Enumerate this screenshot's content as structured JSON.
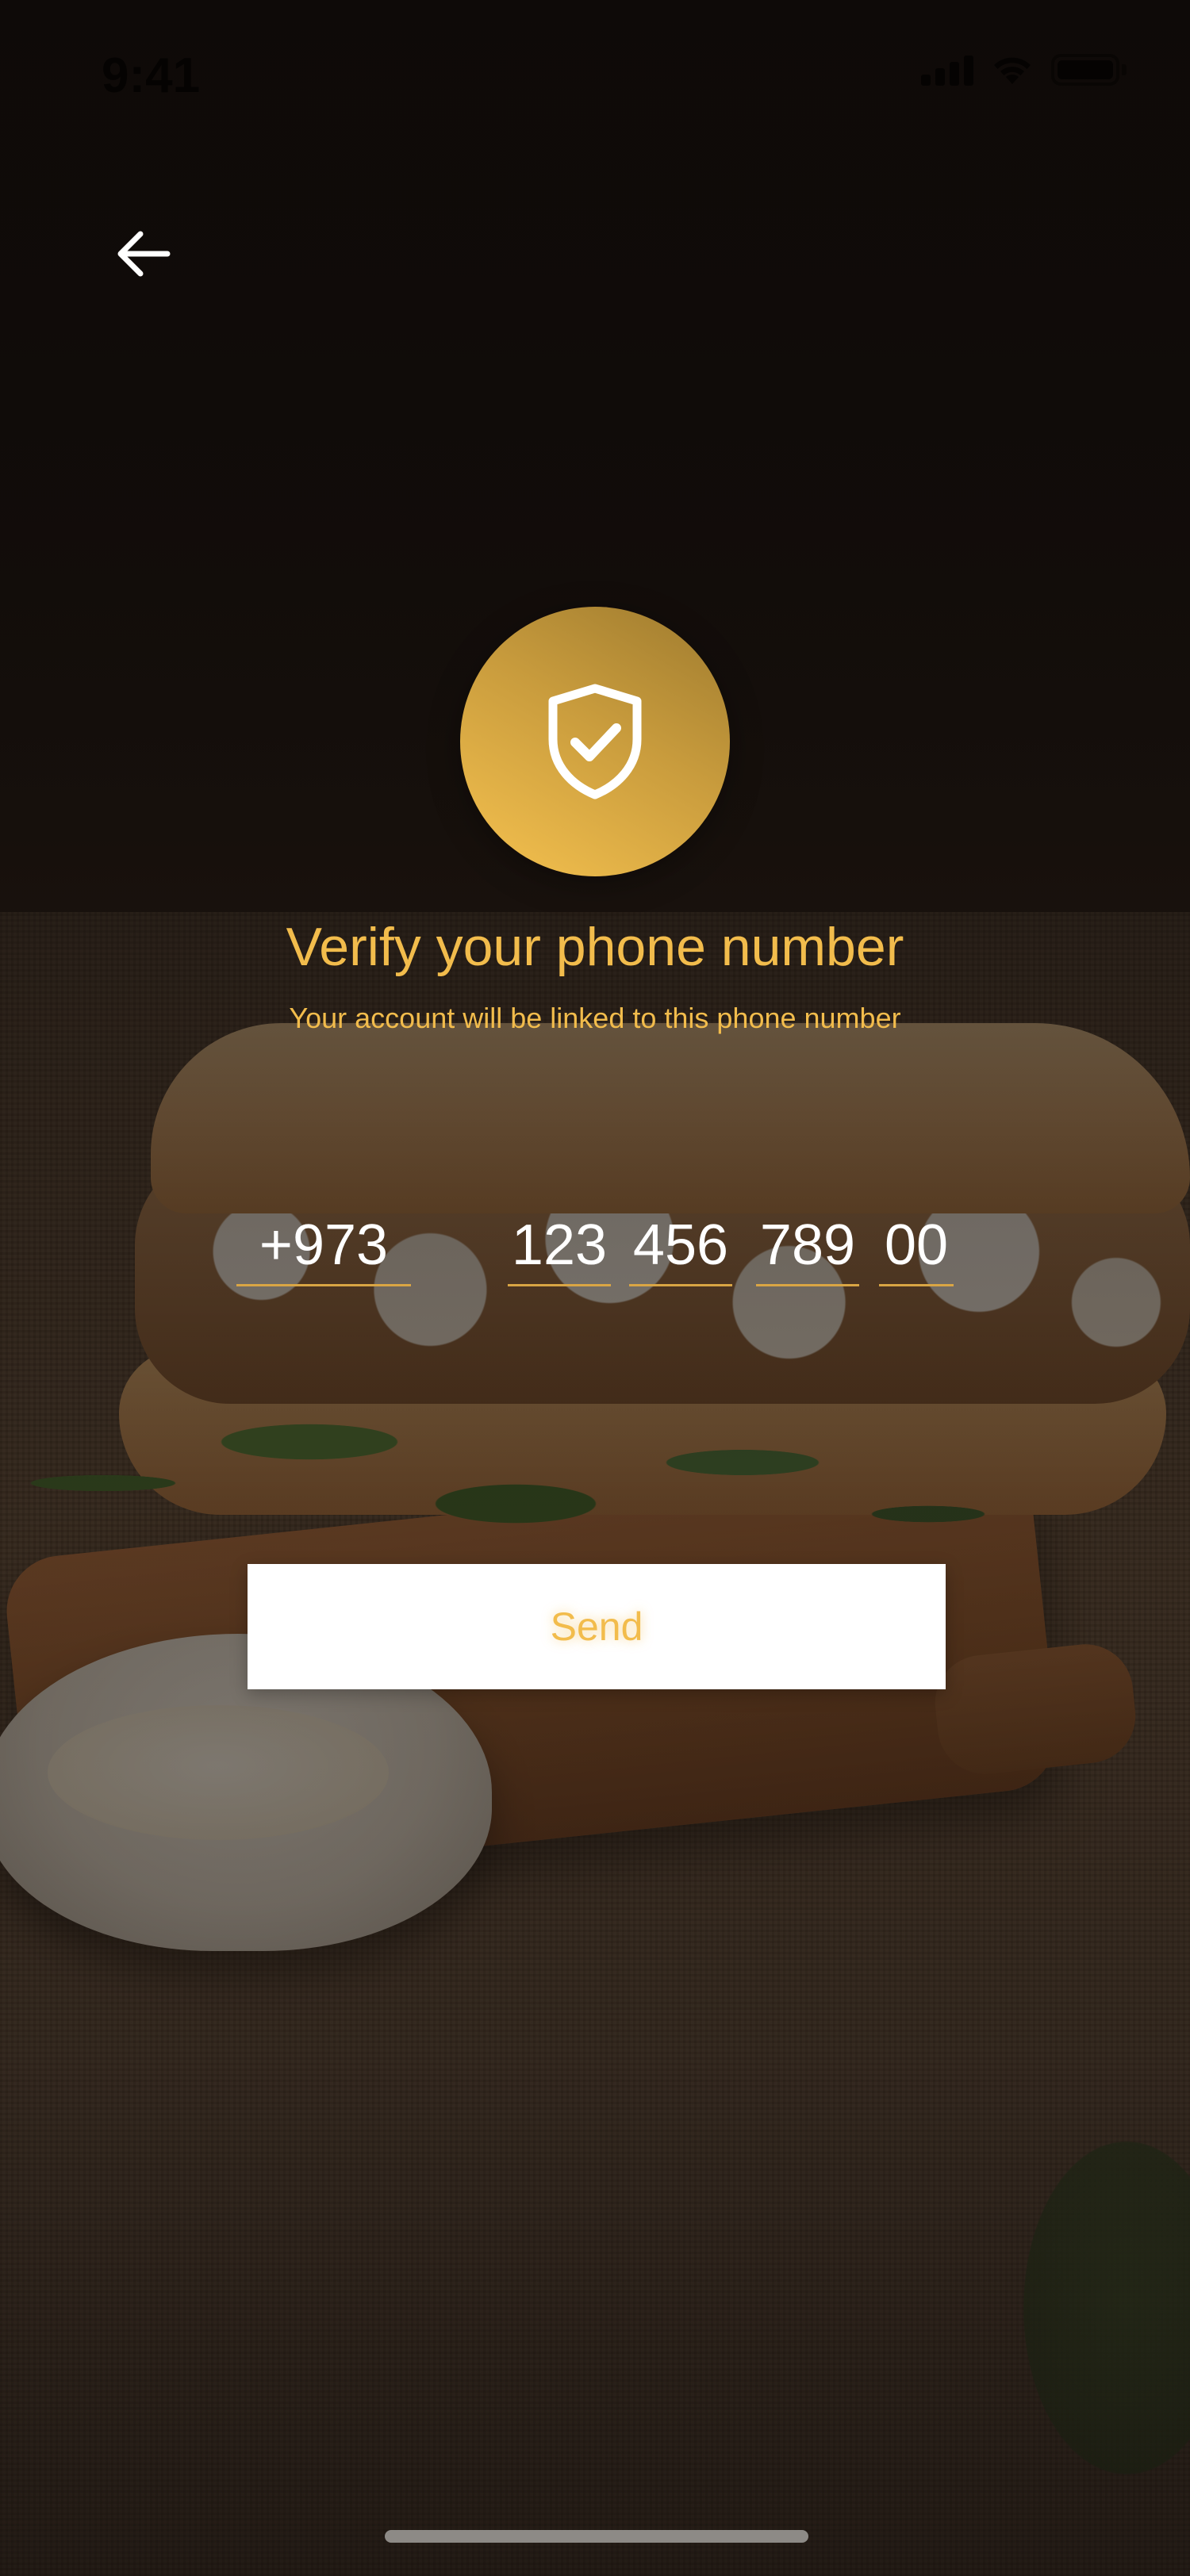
{
  "status_bar": {
    "time": "9:41",
    "icons": [
      "cellular-signal-icon",
      "wifi-icon",
      "battery-icon"
    ]
  },
  "navigation": {
    "back_icon": "arrow-left-icon"
  },
  "badge": {
    "icon": "shield-check-icon",
    "gradient_colors": [
      "#f6c24f",
      "#9d7a2e"
    ]
  },
  "verification": {
    "title": "Verify your phone number",
    "subtitle": "Your account will be linked to this phone number"
  },
  "phone": {
    "country_code": "+973",
    "segments": [
      "123",
      "456",
      "789",
      "00"
    ]
  },
  "actions": {
    "send_label": "Send"
  },
  "colors": {
    "accent": "#f2bc4c",
    "button_background": "#ffffff",
    "input_text": "#ffffff"
  }
}
